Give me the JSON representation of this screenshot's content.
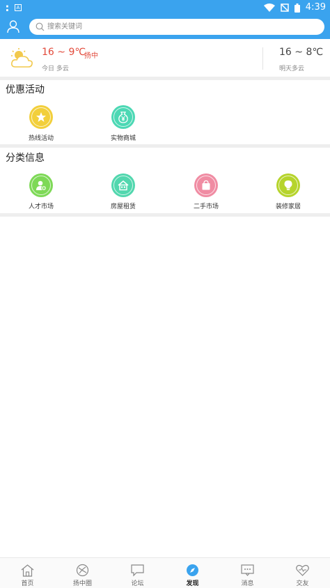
{
  "status_bar": {
    "time": "4:39"
  },
  "search": {
    "placeholder": "搜索关键词"
  },
  "weather": {
    "today_temp": "16 ~ 9℃",
    "city": "扬中",
    "today_desc": "今日 多云",
    "tomorrow_temp": "16 ~ 8℃",
    "tomorrow_desc": "明天多云"
  },
  "promotions": {
    "title": "优惠活动",
    "items": [
      {
        "label": "热线活动",
        "icon": "star-icon",
        "color": "#f2cf3b"
      },
      {
        "label": "实物商城",
        "icon": "yuan-bag-icon",
        "color": "#4cd8b4"
      }
    ]
  },
  "categories": {
    "title": "分类信息",
    "items": [
      {
        "label": "人才市场",
        "icon": "person-add-icon",
        "color": "#7ed957"
      },
      {
        "label": "房屋租赁",
        "icon": "house-icon",
        "color": "#52d7ae"
      },
      {
        "label": "二手市场",
        "icon": "shopping-bag-icon",
        "color": "#f08ca3"
      },
      {
        "label": "装修家居",
        "icon": "lightbulb-icon",
        "color": "#b6d42c"
      }
    ]
  },
  "tab_bar": {
    "items": [
      {
        "label": "首页",
        "icon": "home-icon"
      },
      {
        "label": "扬中圈",
        "icon": "circle-compass-icon"
      },
      {
        "label": "论坛",
        "icon": "chat-bubble-icon"
      },
      {
        "label": "发现",
        "icon": "discover-icon",
        "active": true
      },
      {
        "label": "消息",
        "icon": "message-icon"
      },
      {
        "label": "交友",
        "icon": "heart-icon"
      }
    ]
  },
  "colors": {
    "header": "#3aa3ee",
    "active_tab": "#3aa3ee",
    "weather_accent": "#e24a3b"
  }
}
